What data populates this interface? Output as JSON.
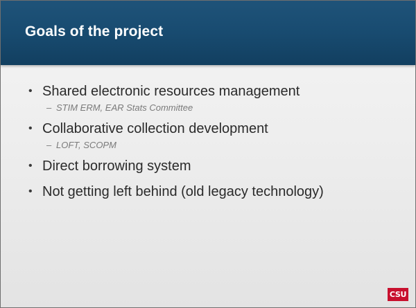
{
  "slide": {
    "title": "Goals of the project",
    "bullets": [
      {
        "text": "Shared electronic resources management",
        "sub": "STIM ERM, EAR Stats Committee"
      },
      {
        "text": "Collaborative collection development",
        "sub": "LOFT, SCOPM"
      },
      {
        "text": "Direct borrowing system"
      },
      {
        "text": "Not getting left behind (old legacy technology)"
      }
    ],
    "bullet_symbol": "•",
    "sub_symbol": "–"
  },
  "logo": {
    "text": "CSU",
    "color": "#c8102e"
  },
  "colors": {
    "title_bar": "#1b4b70",
    "title_text": "#ffffff",
    "body_text": "#2a2a2a",
    "sub_text": "#7a7a7a"
  }
}
